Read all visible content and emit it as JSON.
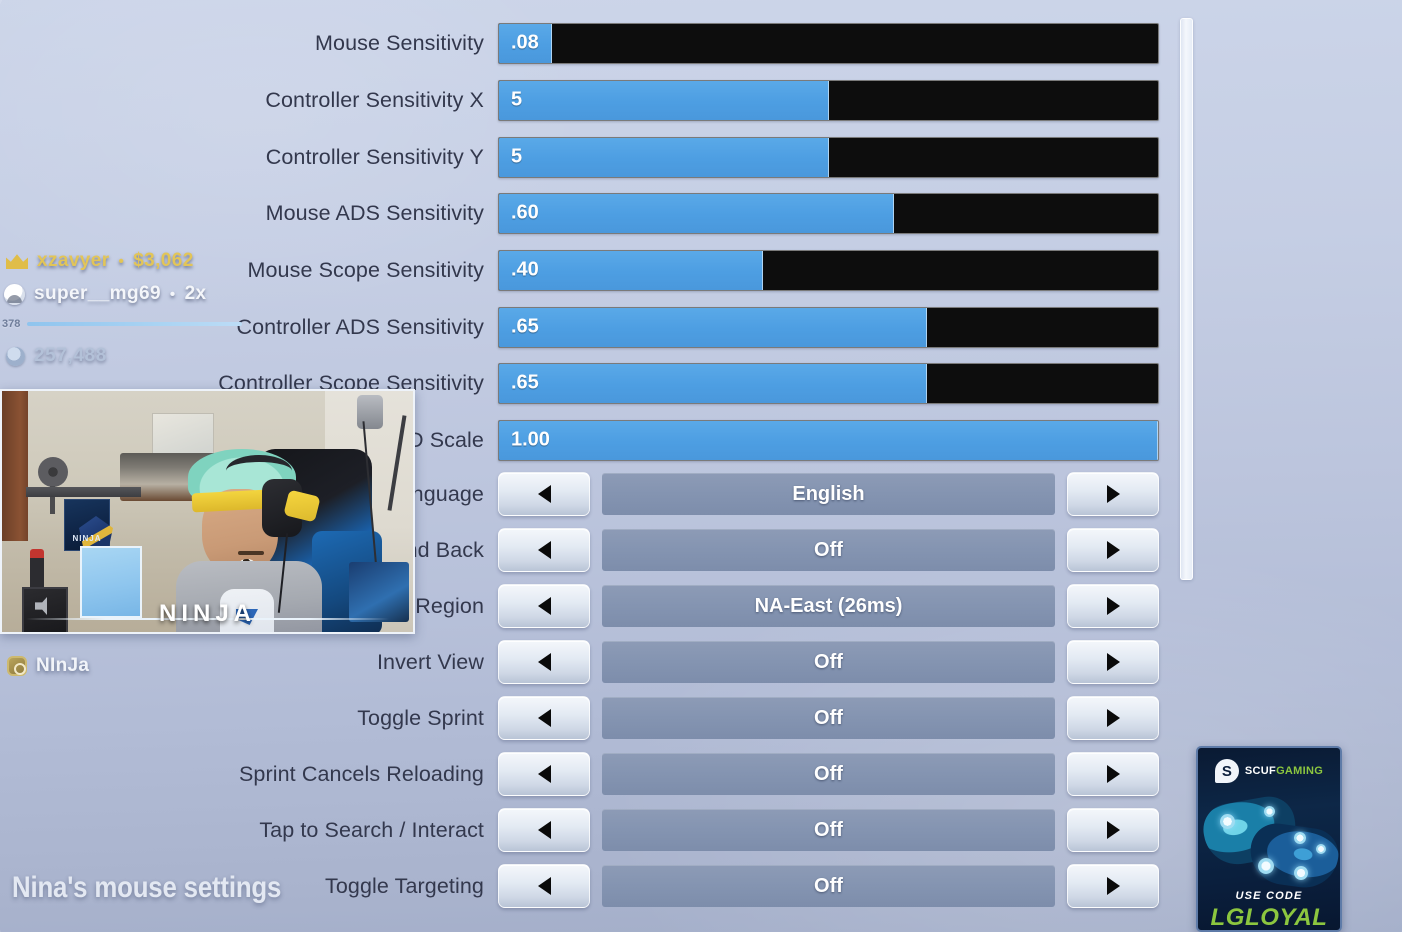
{
  "theme": {
    "accent_blue": "#4d9ee2",
    "track_black": "#0d0d0d",
    "value_box": "#8494b1",
    "label_text": "#33384d",
    "background": "#c0c9e0"
  },
  "settings_panel": {
    "sliders": [
      {
        "label": "Mouse Sensitivity",
        "value": ".08",
        "fill_percent": 8
      },
      {
        "label": "Controller Sensitivity X",
        "value": "5",
        "fill_percent": 50
      },
      {
        "label": "Controller Sensitivity Y",
        "value": "5",
        "fill_percent": 50
      },
      {
        "label": "Mouse ADS Sensitivity",
        "value": ".60",
        "fill_percent": 60
      },
      {
        "label": "Mouse Scope Sensitivity",
        "value": ".40",
        "fill_percent": 40
      },
      {
        "label": "Controller ADS Sensitivity",
        "value": ".65",
        "fill_percent": 65
      },
      {
        "label": "Controller Scope Sensitivity",
        "value": ".65",
        "fill_percent": 65
      },
      {
        "label": "HUD Scale",
        "value": "1.00",
        "fill_percent": 100
      }
    ],
    "dropdowns": [
      {
        "label": "Language",
        "value": "English"
      },
      {
        "label": "Hold to Sprint and Back",
        "value": "Off"
      },
      {
        "label": "Matchmaking Region",
        "value": "NA-East (26ms)"
      },
      {
        "label": "Invert View",
        "value": "Off"
      },
      {
        "label": "Toggle Sprint",
        "value": "Off"
      },
      {
        "label": "Sprint Cancels Reloading",
        "value": "Off"
      },
      {
        "label": "Tap to Search / Interact",
        "value": "Off"
      },
      {
        "label": "Toggle Targeting",
        "value": "Off"
      }
    ],
    "arrow_left_icon": "chevron-left-icon",
    "arrow_right_icon": "chevron-right-icon"
  },
  "stream_overlay": {
    "alerts": [
      {
        "icon": "crown-icon",
        "name": "xzavyer",
        "separator": "•",
        "amount": "$3,062"
      },
      {
        "icon": "subscriber-icon",
        "name": "super__mg69",
        "separator": "•",
        "amount": "2x"
      }
    ],
    "progress": {
      "value": "378"
    },
    "points": {
      "icon": "coin-icon",
      "value": "257,488"
    },
    "social": {
      "icon": "instagram-icon",
      "handle": "NInJa"
    },
    "caption": "Nina's mouse settings",
    "webcam": {
      "logo_text": "NINJA",
      "monitor_text": "NINJA"
    }
  },
  "ad": {
    "logo_letter": "S",
    "brand_part1": "SCUF",
    "brand_part2": "GAMING",
    "use_code_label": "USE CODE",
    "code": "LGLOYAL"
  }
}
